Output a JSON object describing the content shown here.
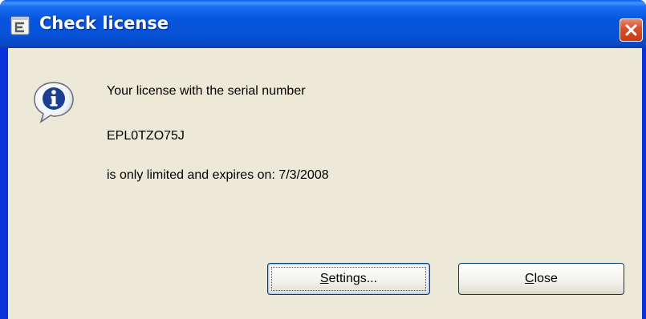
{
  "window": {
    "title": "Check license",
    "icons": {
      "app": "app-icon",
      "close": "close-icon",
      "info": "info-icon"
    }
  },
  "message": {
    "line1": "Your license with the serial number",
    "serial": "EPL0TZO75J",
    "line3": "is only limited and expires on: 7/3/2008"
  },
  "buttons": {
    "settings": {
      "mnemonic": "S",
      "rest": "ettings..."
    },
    "close": {
      "mnemonic": "C",
      "rest": "lose"
    }
  },
  "colors": {
    "titlebar": "#0855dd",
    "client": "#ece9d8",
    "close_button": "#d9502d"
  }
}
